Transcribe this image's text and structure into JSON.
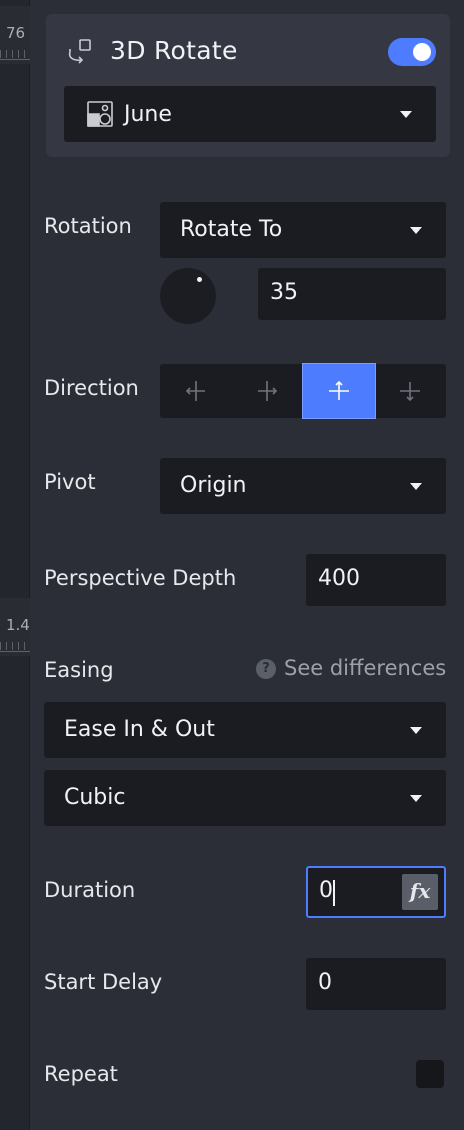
{
  "timeline": {
    "ruler_top_value": "76",
    "ruler_mid_value": "1.4"
  },
  "header": {
    "icon": "rotate-3d-icon",
    "title": "3D Rotate",
    "enabled": true,
    "target": {
      "icon": "image-shapes-icon",
      "label": "June"
    }
  },
  "rotation": {
    "label": "Rotation",
    "mode": "Rotate To",
    "angle": "35"
  },
  "direction": {
    "label": "Direction",
    "options": [
      {
        "icon": "rotate-horizontal-left-icon",
        "active": false
      },
      {
        "icon": "rotate-horizontal-right-icon",
        "active": false
      },
      {
        "icon": "rotate-vertical-up-icon",
        "active": true
      },
      {
        "icon": "rotate-vertical-down-icon",
        "active": false
      }
    ]
  },
  "pivot": {
    "label": "Pivot",
    "value": "Origin"
  },
  "perspective": {
    "label": "Perspective Depth",
    "value": "400"
  },
  "easing": {
    "label": "Easing",
    "help_icon": "question-circle-icon",
    "help_text": "See differences",
    "curve": "Ease In & Out",
    "type": "Cubic"
  },
  "duration": {
    "label": "Duration",
    "value": "0",
    "fx_label": "fx"
  },
  "start_delay": {
    "label": "Start Delay",
    "value": "0"
  },
  "repeat": {
    "label": "Repeat",
    "checked": false
  },
  "colors": {
    "accent": "#4d7cff",
    "panel": "#2b2e36",
    "field": "#1a1c21"
  }
}
